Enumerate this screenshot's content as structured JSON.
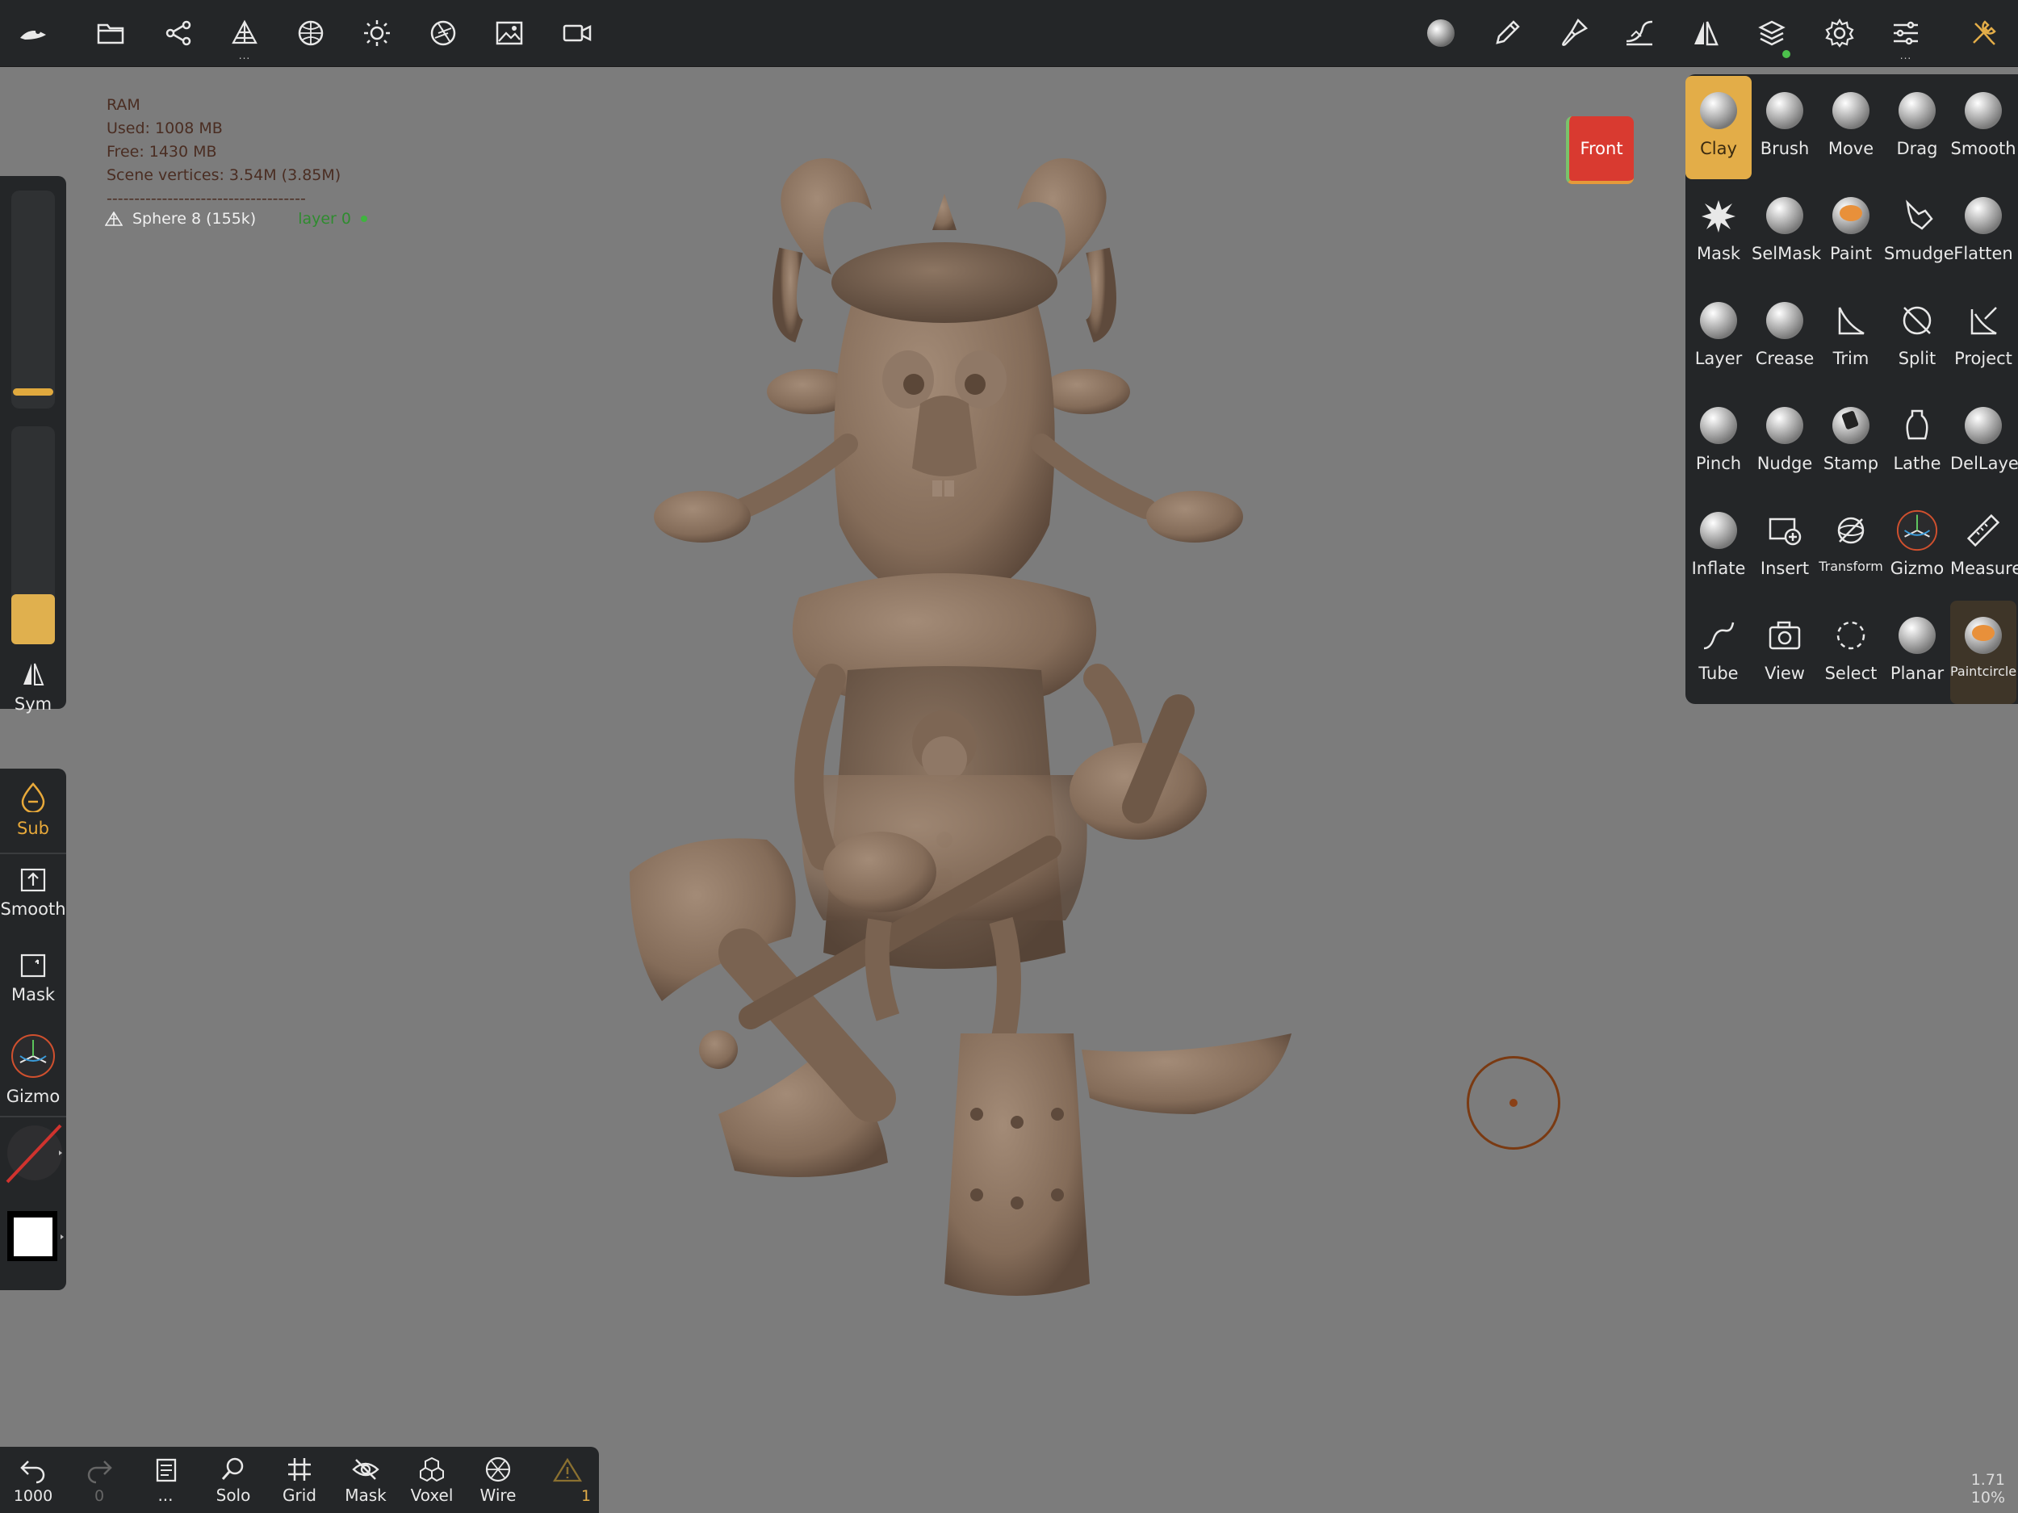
{
  "stats": {
    "ram_label": "RAM",
    "used": "Used: 1008 MB",
    "free": "Free: 1430 MB",
    "vertices": "Scene vertices: 3.54M (3.85M)",
    "separator": "------------------------------------",
    "mesh_name": "Sphere 8 (155k)",
    "layer_name": "layer 0"
  },
  "front_cube_label": "Front",
  "left_panel": {
    "sym_label": "Sym",
    "sub_label": "Sub",
    "smooth_label": "Smooth",
    "mask_label": "Mask",
    "gizmo_label": "Gizmo"
  },
  "tools": [
    {
      "label": "Clay",
      "icon": "sphere-icon"
    },
    {
      "label": "Brush",
      "icon": "sphere-icon"
    },
    {
      "label": "Move",
      "icon": "sphere-icon"
    },
    {
      "label": "Drag",
      "icon": "sphere-icon"
    },
    {
      "label": "Smooth",
      "icon": "sphere-icon"
    },
    {
      "label": "Mask",
      "icon": "splat-icon"
    },
    {
      "label": "SelMask",
      "icon": "sphere-icon"
    },
    {
      "label": "Paint",
      "icon": "sphere-icon"
    },
    {
      "label": "Smudge",
      "icon": "finger-icon"
    },
    {
      "label": "Flatten",
      "icon": "sphere-icon"
    },
    {
      "label": "Layer",
      "icon": "sphere-icon"
    },
    {
      "label": "Crease",
      "icon": "sphere-icon"
    },
    {
      "label": "Trim",
      "icon": "trim-icon"
    },
    {
      "label": "Split",
      "icon": "split-icon"
    },
    {
      "label": "Project",
      "icon": "project-icon"
    },
    {
      "label": "Pinch",
      "icon": "sphere-icon"
    },
    {
      "label": "Nudge",
      "icon": "sphere-icon"
    },
    {
      "label": "Stamp",
      "icon": "sphere-icon"
    },
    {
      "label": "Lathe",
      "icon": "vase-icon"
    },
    {
      "label": "DelLayer",
      "icon": "sphere-icon"
    },
    {
      "label": "Inflate",
      "icon": "sphere-icon"
    },
    {
      "label": "Insert",
      "icon": "insert-icon"
    },
    {
      "label": "Transform",
      "icon": "transform-icon"
    },
    {
      "label": "Gizmo",
      "icon": "gizmo-icon"
    },
    {
      "label": "Measure",
      "icon": "ruler-icon"
    },
    {
      "label": "Tube",
      "icon": "curve-icon"
    },
    {
      "label": "View",
      "icon": "camera-icon"
    },
    {
      "label": "Select",
      "icon": "dashed-circle-icon"
    },
    {
      "label": "Planar",
      "icon": "sphere-icon"
    },
    {
      "label": "Paintcircle",
      "icon": "sphere-icon"
    }
  ],
  "bottom_bar": {
    "undo_count": "1000",
    "redo_count": "0",
    "more_label": "...",
    "solo_label": "Solo",
    "grid_label": "Grid",
    "mask_label": "Mask",
    "voxel_label": "Voxel",
    "wire_label": "Wire",
    "warning_count": "1"
  },
  "zoom": {
    "line1": "1.71",
    "line2": "10%"
  },
  "colors": {
    "accent": "#e3ad48",
    "panel": "#242628",
    "viewport": "#7c7c7c",
    "clay": "#8a7462"
  }
}
